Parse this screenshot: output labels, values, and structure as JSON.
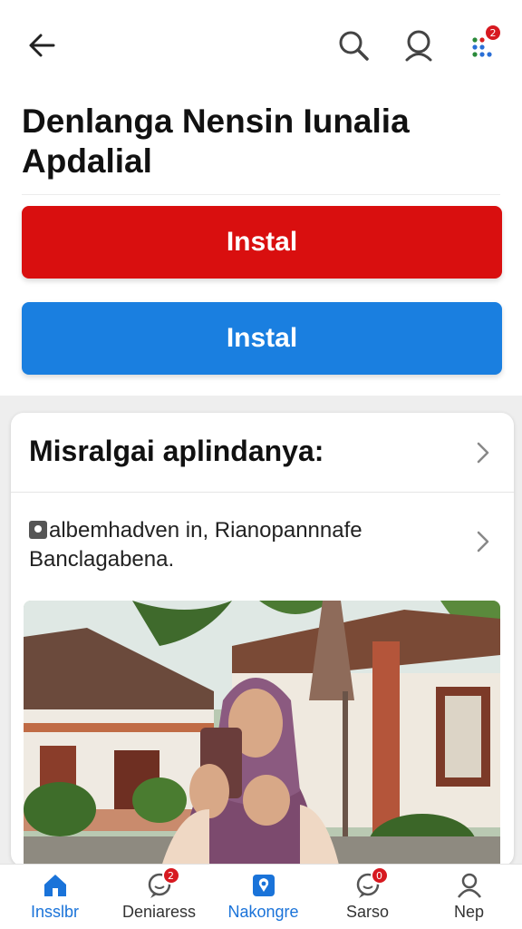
{
  "header": {
    "notification_count": "2"
  },
  "title": "Denlanga Nensin Iunalia Apdalial",
  "buttons": {
    "primary_red": "Instal",
    "primary_blue": "Instal"
  },
  "card": {
    "heading": "Misralgai aplindanya:",
    "row_text": "albemhadven in, Rianopannnafe Banclagabena."
  },
  "bottom_nav": {
    "items": [
      {
        "label": "Insslbr",
        "icon": "home-icon",
        "active": true
      },
      {
        "label": "Deniaress",
        "icon": "chat-icon",
        "badge": "2"
      },
      {
        "label": "Nakongre",
        "icon": "map-pin-icon"
      },
      {
        "label": "Sarso",
        "icon": "chat-icon",
        "badge": "0"
      },
      {
        "label": "Nep",
        "icon": "profile-icon"
      }
    ]
  },
  "colors": {
    "red": "#d90f0f",
    "blue": "#1a7fe0",
    "active_nav": "#1a73d9"
  }
}
